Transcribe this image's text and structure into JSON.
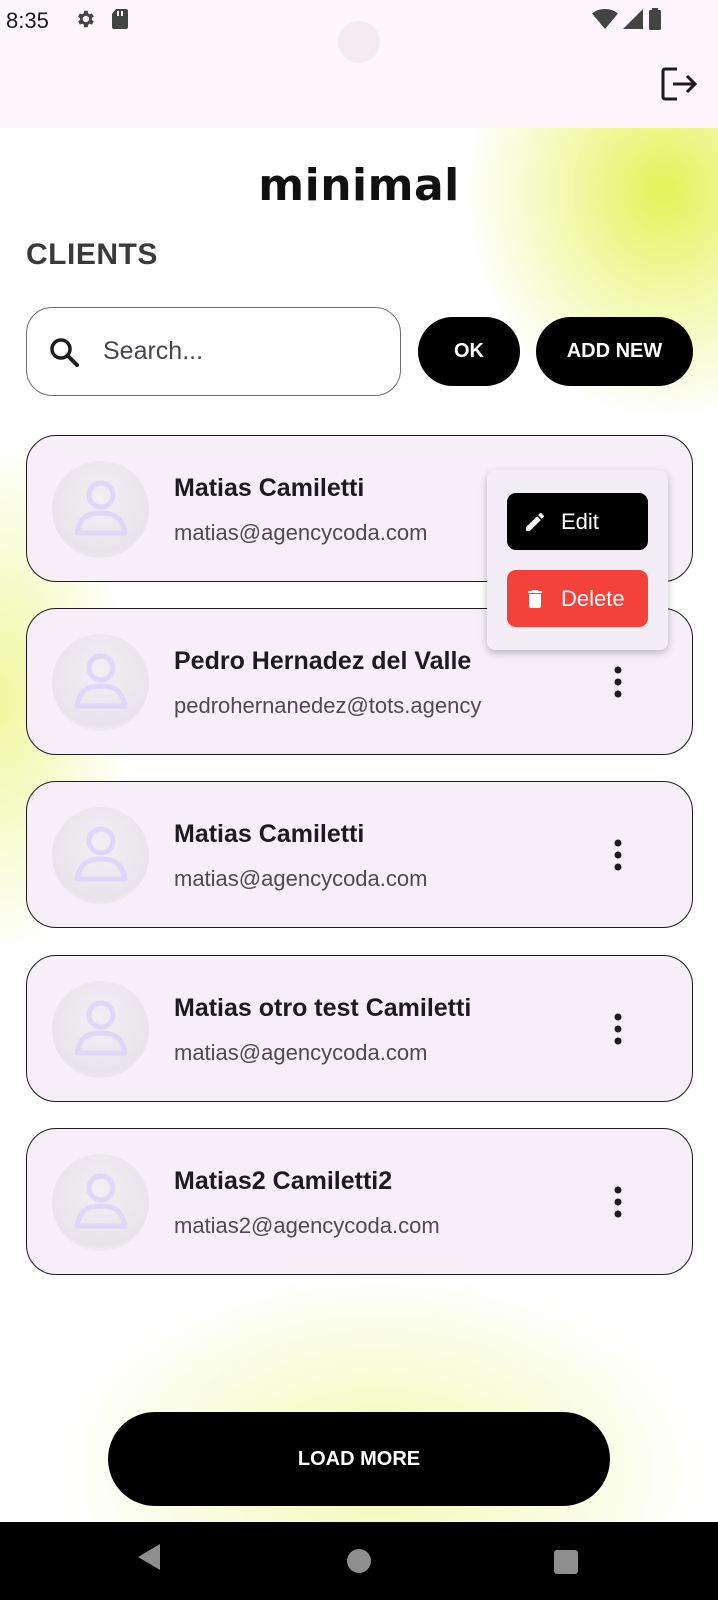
{
  "status_bar": {
    "time": "8:35",
    "left_icons": [
      "gear-icon",
      "sd-card-icon"
    ],
    "right_icons": [
      "wifi-icon",
      "signal-icon",
      "battery-icon"
    ]
  },
  "app_bar": {
    "logout_icon": "logout-icon"
  },
  "brand": "minimal",
  "page_title": "CLIENTS",
  "search": {
    "placeholder": "Search...",
    "value": ""
  },
  "actions": {
    "ok_label": "OK",
    "add_new_label": "ADD NEW"
  },
  "clients": [
    {
      "name": "Matias Camiletti",
      "email": "matias@agencycoda.com"
    },
    {
      "name": "Pedro Hernadez del Valle",
      "email": "pedrohernanedez@tots.agency"
    },
    {
      "name": "Matias Camiletti",
      "email": "matias@agencycoda.com"
    },
    {
      "name": "Matias otro test Camiletti",
      "email": "matias@agencycoda.com"
    },
    {
      "name": "Matias2 Camiletti2",
      "email": "matias2@agencycoda.com"
    }
  ],
  "context_menu": {
    "edit_label": "Edit",
    "delete_label": "Delete",
    "colors": {
      "edit_bg": "#000000",
      "delete_bg": "#f4413a"
    }
  },
  "load_more_label": "LOAD MORE",
  "colors": {
    "accent": "#000000",
    "card_bg": "#f6eff7",
    "highlight": "#e2f250"
  }
}
